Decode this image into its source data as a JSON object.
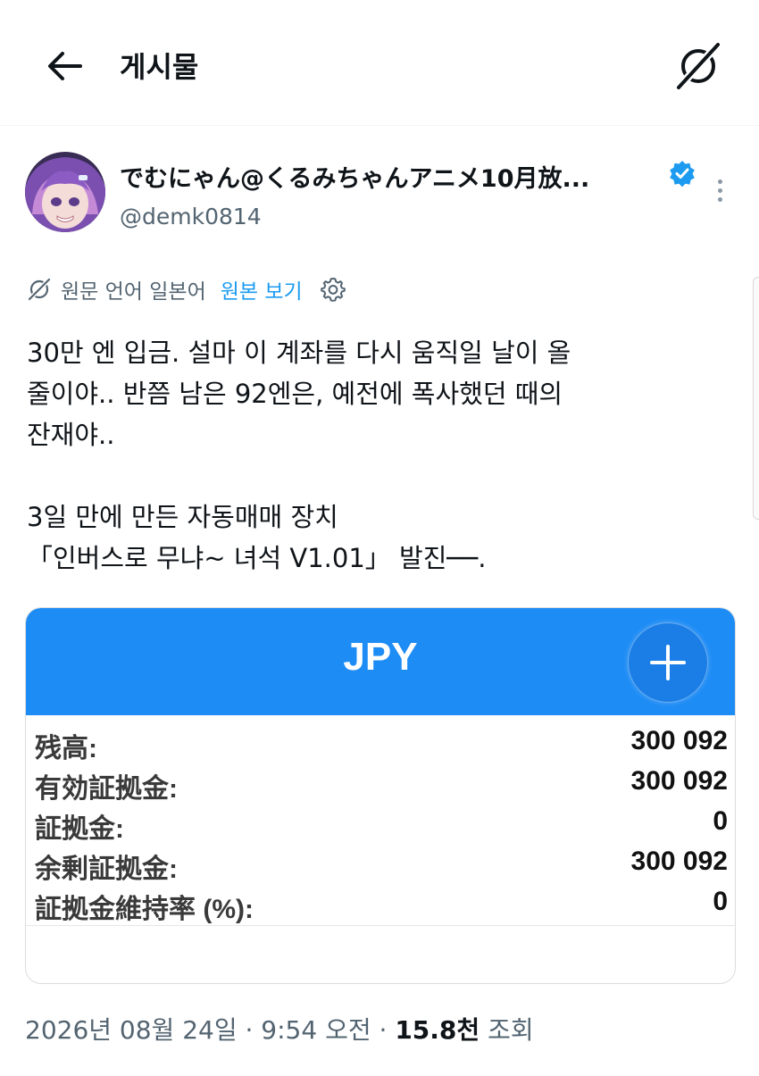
{
  "header": {
    "title": "게시물",
    "back_icon": "arrow-left-icon",
    "translate_icon": "translate-globe-icon"
  },
  "author": {
    "display_name": "でむにゃん@くるみちゃんアニメ10月放...",
    "handle": "@demk0814",
    "verified": true,
    "verified_color": "#1d9bf0"
  },
  "translation": {
    "label": "원문 언어 일본어",
    "view_original": "원본 보기",
    "settings_icon": "gear-icon"
  },
  "tweet": {
    "text": "30만 엔 입금. 설마 이 계좌를 다시 움직일 날이 올\n줄이야.. 반쯤 남은 92엔은, 예전에 폭사했던 때의\n잔재야..\n\n3일 만에 만든 자동매매 장치\n「인버스로 무냐~ 녀석 V1.01」 발진──."
  },
  "media": {
    "currency": "JPY",
    "accent": "#1e8cf5",
    "rows": [
      {
        "label": "残高:",
        "value": "300 092"
      },
      {
        "label": "有効証拠金:",
        "value": "300 092"
      },
      {
        "label": "証拠金:",
        "value": "0"
      },
      {
        "label": "余剰証拠金:",
        "value": "300 092"
      },
      {
        "label": "証拠金維持率 (%):",
        "value": "0"
      }
    ]
  },
  "meta": {
    "date": "2026년 08월 24일 · 9:54 오전",
    "separator": "·",
    "views_count": "15.8천",
    "views_label": "조회"
  }
}
